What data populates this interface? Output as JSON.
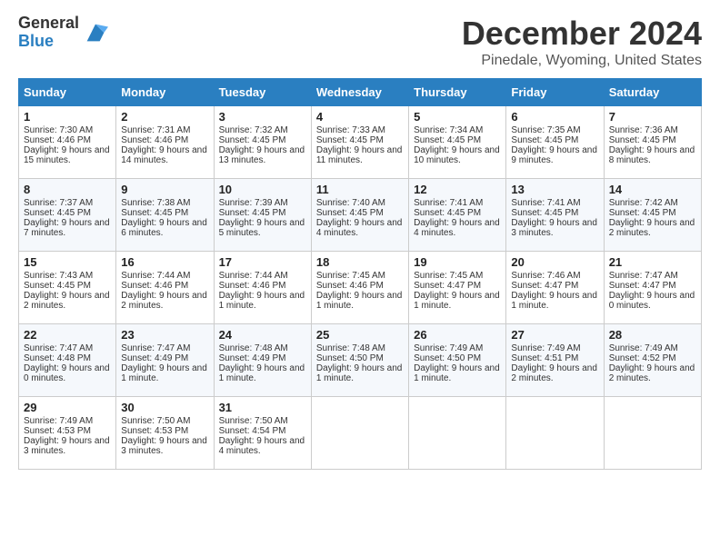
{
  "logo": {
    "general": "General",
    "blue": "Blue"
  },
  "title": "December 2024",
  "location": "Pinedale, Wyoming, United States",
  "days_of_week": [
    "Sunday",
    "Monday",
    "Tuesday",
    "Wednesday",
    "Thursday",
    "Friday",
    "Saturday"
  ],
  "weeks": [
    [
      {
        "day": "1",
        "sunrise": "7:30 AM",
        "sunset": "4:46 PM",
        "daylight": "9 hours and 15 minutes."
      },
      {
        "day": "2",
        "sunrise": "7:31 AM",
        "sunset": "4:46 PM",
        "daylight": "9 hours and 14 minutes."
      },
      {
        "day": "3",
        "sunrise": "7:32 AM",
        "sunset": "4:45 PM",
        "daylight": "9 hours and 13 minutes."
      },
      {
        "day": "4",
        "sunrise": "7:33 AM",
        "sunset": "4:45 PM",
        "daylight": "9 hours and 11 minutes."
      },
      {
        "day": "5",
        "sunrise": "7:34 AM",
        "sunset": "4:45 PM",
        "daylight": "9 hours and 10 minutes."
      },
      {
        "day": "6",
        "sunrise": "7:35 AM",
        "sunset": "4:45 PM",
        "daylight": "9 hours and 9 minutes."
      },
      {
        "day": "7",
        "sunrise": "7:36 AM",
        "sunset": "4:45 PM",
        "daylight": "9 hours and 8 minutes."
      }
    ],
    [
      {
        "day": "8",
        "sunrise": "7:37 AM",
        "sunset": "4:45 PM",
        "daylight": "9 hours and 7 minutes."
      },
      {
        "day": "9",
        "sunrise": "7:38 AM",
        "sunset": "4:45 PM",
        "daylight": "9 hours and 6 minutes."
      },
      {
        "day": "10",
        "sunrise": "7:39 AM",
        "sunset": "4:45 PM",
        "daylight": "9 hours and 5 minutes."
      },
      {
        "day": "11",
        "sunrise": "7:40 AM",
        "sunset": "4:45 PM",
        "daylight": "9 hours and 4 minutes."
      },
      {
        "day": "12",
        "sunrise": "7:41 AM",
        "sunset": "4:45 PM",
        "daylight": "9 hours and 4 minutes."
      },
      {
        "day": "13",
        "sunrise": "7:41 AM",
        "sunset": "4:45 PM",
        "daylight": "9 hours and 3 minutes."
      },
      {
        "day": "14",
        "sunrise": "7:42 AM",
        "sunset": "4:45 PM",
        "daylight": "9 hours and 2 minutes."
      }
    ],
    [
      {
        "day": "15",
        "sunrise": "7:43 AM",
        "sunset": "4:45 PM",
        "daylight": "9 hours and 2 minutes."
      },
      {
        "day": "16",
        "sunrise": "7:44 AM",
        "sunset": "4:46 PM",
        "daylight": "9 hours and 2 minutes."
      },
      {
        "day": "17",
        "sunrise": "7:44 AM",
        "sunset": "4:46 PM",
        "daylight": "9 hours and 1 minute."
      },
      {
        "day": "18",
        "sunrise": "7:45 AM",
        "sunset": "4:46 PM",
        "daylight": "9 hours and 1 minute."
      },
      {
        "day": "19",
        "sunrise": "7:45 AM",
        "sunset": "4:47 PM",
        "daylight": "9 hours and 1 minute."
      },
      {
        "day": "20",
        "sunrise": "7:46 AM",
        "sunset": "4:47 PM",
        "daylight": "9 hours and 1 minute."
      },
      {
        "day": "21",
        "sunrise": "7:47 AM",
        "sunset": "4:47 PM",
        "daylight": "9 hours and 0 minutes."
      }
    ],
    [
      {
        "day": "22",
        "sunrise": "7:47 AM",
        "sunset": "4:48 PM",
        "daylight": "9 hours and 0 minutes."
      },
      {
        "day": "23",
        "sunrise": "7:47 AM",
        "sunset": "4:49 PM",
        "daylight": "9 hours and 1 minute."
      },
      {
        "day": "24",
        "sunrise": "7:48 AM",
        "sunset": "4:49 PM",
        "daylight": "9 hours and 1 minute."
      },
      {
        "day": "25",
        "sunrise": "7:48 AM",
        "sunset": "4:50 PM",
        "daylight": "9 hours and 1 minute."
      },
      {
        "day": "26",
        "sunrise": "7:49 AM",
        "sunset": "4:50 PM",
        "daylight": "9 hours and 1 minute."
      },
      {
        "day": "27",
        "sunrise": "7:49 AM",
        "sunset": "4:51 PM",
        "daylight": "9 hours and 2 minutes."
      },
      {
        "day": "28",
        "sunrise": "7:49 AM",
        "sunset": "4:52 PM",
        "daylight": "9 hours and 2 minutes."
      }
    ],
    [
      {
        "day": "29",
        "sunrise": "7:49 AM",
        "sunset": "4:53 PM",
        "daylight": "9 hours and 3 minutes."
      },
      {
        "day": "30",
        "sunrise": "7:50 AM",
        "sunset": "4:53 PM",
        "daylight": "9 hours and 3 minutes."
      },
      {
        "day": "31",
        "sunrise": "7:50 AM",
        "sunset": "4:54 PM",
        "daylight": "9 hours and 4 minutes."
      },
      null,
      null,
      null,
      null
    ]
  ],
  "labels": {
    "sunrise": "Sunrise:",
    "sunset": "Sunset:",
    "daylight": "Daylight:"
  }
}
